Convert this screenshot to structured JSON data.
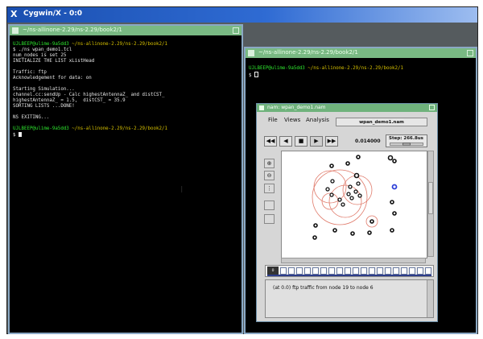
{
  "root_window": {
    "title": "Cygwin/X - 0:0",
    "logo": "X"
  },
  "left_xterm": {
    "title": "~/ns-allinone-2.29/ns-2.29/book2/1",
    "lines": [
      {
        "user": "UJLBEEP@ulime-9a5dd3",
        "path": " ~/ns-allinone-2.29/ns-2.29/book2/1"
      },
      {
        "text": "$ ./ns wpan_demo1.tcl"
      },
      {
        "text": "num_nodes is set 25"
      },
      {
        "text": "INITIALIZE THE LIST xListHead"
      },
      {
        "text": ""
      },
      {
        "text": "Traffic: ftp"
      },
      {
        "text": "Acknowledgement for data: on"
      },
      {
        "text": ""
      },
      {
        "text": "Starting Simulation..."
      },
      {
        "text": "channel.cc:sendUp - Calc highestAntennaZ_ and distCST_"
      },
      {
        "text": "highestAntennaZ_ = 1.5,  distCST_ = 35.9"
      },
      {
        "text": "SORTING LISTS ...DONE!"
      },
      {
        "text": ""
      },
      {
        "text": "NS EXITING..."
      },
      {
        "text": ""
      },
      {
        "user": "UJLBEEP@ulime-9a5dd3",
        "path": " ~/ns-allinone-2.29/ns-2.29/book2/1"
      },
      {
        "text": "$ "
      }
    ]
  },
  "right_xterm": {
    "title": "~/ns-allinone-2.29/ns-2.29/book2/1",
    "prompt_user": "UJLBEEP@ulime-9a5dd3",
    "prompt_path": " ~/ns-allinone-2.29/ns-2.29/book2/1",
    "prompt": "$ "
  },
  "nam": {
    "title": "nam: wpan_demo1.nam",
    "menus": [
      "File",
      "Views",
      "Analysis"
    ],
    "filename": "wpan_demo1.nam",
    "controls": [
      "rewind",
      "back",
      "stop",
      "play",
      "fast-forward"
    ],
    "controls_glyphs": [
      "◀◀",
      "◀",
      "■",
      "▶",
      "▶▶"
    ],
    "time": "0.014000",
    "step": "Step: 266.8us",
    "step_level": 0.5,
    "annotation": "(at 0.0) ftp traffic from node 19 to node 6",
    "timeline_marker": "0"
  },
  "colors": {
    "xterm_title": "#79b983",
    "prompt_user": "#2ee62e",
    "prompt_path": "#d8c200",
    "nam_title": "#6fb27c",
    "range_circle": "#e07a6a",
    "highlight_node": "#2d3fd8"
  }
}
